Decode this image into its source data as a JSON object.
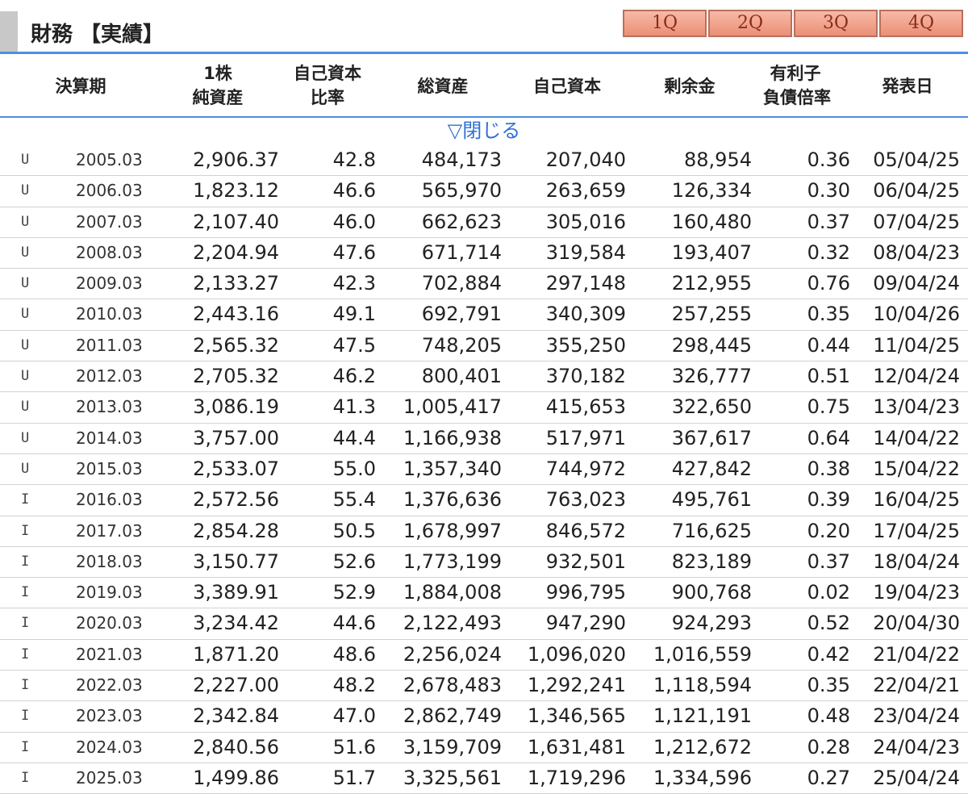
{
  "header": {
    "title": "財務 【実績】",
    "tabs": [
      "1Q",
      "2Q",
      "3Q",
      "4Q"
    ]
  },
  "columns": {
    "period": "決算期",
    "bvps_1": "1株",
    "bvps_2": "純資産",
    "equity_ratio_1": "自己資本",
    "equity_ratio_2": "比率",
    "total_assets": "総資産",
    "equity": "自己資本",
    "surplus": "剰余金",
    "debt_1": "有利子",
    "debt_2": "負債倍率",
    "announce": "発表日"
  },
  "toggle_label": "▽閉じる",
  "rows": [
    {
      "flag": "U",
      "period": "2005.03",
      "bvps": "2,906.37",
      "ratio": "42.8",
      "assets": "484,173",
      "equity": "207,040",
      "surplus": "88,954",
      "debt": "0.36",
      "date": "05/04/25"
    },
    {
      "flag": "U",
      "period": "2006.03",
      "bvps": "1,823.12",
      "ratio": "46.6",
      "assets": "565,970",
      "equity": "263,659",
      "surplus": "126,334",
      "debt": "0.30",
      "date": "06/04/25"
    },
    {
      "flag": "U",
      "period": "2007.03",
      "bvps": "2,107.40",
      "ratio": "46.0",
      "assets": "662,623",
      "equity": "305,016",
      "surplus": "160,480",
      "debt": "0.37",
      "date": "07/04/25"
    },
    {
      "flag": "U",
      "period": "2008.03",
      "bvps": "2,204.94",
      "ratio": "47.6",
      "assets": "671,714",
      "equity": "319,584",
      "surplus": "193,407",
      "debt": "0.32",
      "date": "08/04/23"
    },
    {
      "flag": "U",
      "period": "2009.03",
      "bvps": "2,133.27",
      "ratio": "42.3",
      "assets": "702,884",
      "equity": "297,148",
      "surplus": "212,955",
      "debt": "0.76",
      "date": "09/04/24"
    },
    {
      "flag": "U",
      "period": "2010.03",
      "bvps": "2,443.16",
      "ratio": "49.1",
      "assets": "692,791",
      "equity": "340,309",
      "surplus": "257,255",
      "debt": "0.35",
      "date": "10/04/26"
    },
    {
      "flag": "U",
      "period": "2011.03",
      "bvps": "2,565.32",
      "ratio": "47.5",
      "assets": "748,205",
      "equity": "355,250",
      "surplus": "298,445",
      "debt": "0.44",
      "date": "11/04/25"
    },
    {
      "flag": "U",
      "period": "2012.03",
      "bvps": "2,705.32",
      "ratio": "46.2",
      "assets": "800,401",
      "equity": "370,182",
      "surplus": "326,777",
      "debt": "0.51",
      "date": "12/04/24"
    },
    {
      "flag": "U",
      "period": "2013.03",
      "bvps": "3,086.19",
      "ratio": "41.3",
      "assets": "1,005,417",
      "equity": "415,653",
      "surplus": "322,650",
      "debt": "0.75",
      "date": "13/04/23"
    },
    {
      "flag": "U",
      "period": "2014.03",
      "bvps": "3,757.00",
      "ratio": "44.4",
      "assets": "1,166,938",
      "equity": "517,971",
      "surplus": "367,617",
      "debt": "0.64",
      "date": "14/04/22"
    },
    {
      "flag": "U",
      "period": "2015.03",
      "bvps": "2,533.07",
      "ratio": "55.0",
      "assets": "1,357,340",
      "equity": "744,972",
      "surplus": "427,842",
      "debt": "0.38",
      "date": "15/04/22"
    },
    {
      "flag": "I",
      "period": "2016.03",
      "bvps": "2,572.56",
      "ratio": "55.4",
      "assets": "1,376,636",
      "equity": "763,023",
      "surplus": "495,761",
      "debt": "0.39",
      "date": "16/04/25"
    },
    {
      "flag": "I",
      "period": "2017.03",
      "bvps": "2,854.28",
      "ratio": "50.5",
      "assets": "1,678,997",
      "equity": "846,572",
      "surplus": "716,625",
      "debt": "0.20",
      "date": "17/04/25"
    },
    {
      "flag": "I",
      "period": "2018.03",
      "bvps": "3,150.77",
      "ratio": "52.6",
      "assets": "1,773,199",
      "equity": "932,501",
      "surplus": "823,189",
      "debt": "0.37",
      "date": "18/04/24"
    },
    {
      "flag": "I",
      "period": "2019.03",
      "bvps": "3,389.91",
      "ratio": "52.9",
      "assets": "1,884,008",
      "equity": "996,795",
      "surplus": "900,768",
      "debt": "0.02",
      "date": "19/04/23"
    },
    {
      "flag": "I",
      "period": "2020.03",
      "bvps": "3,234.42",
      "ratio": "44.6",
      "assets": "2,122,493",
      "equity": "947,290",
      "surplus": "924,293",
      "debt": "0.52",
      "date": "20/04/30"
    },
    {
      "flag": "I",
      "period": "2021.03",
      "bvps": "1,871.20",
      "ratio": "48.6",
      "assets": "2,256,024",
      "equity": "1,096,020",
      "surplus": "1,016,559",
      "debt": "0.42",
      "date": "21/04/22"
    },
    {
      "flag": "I",
      "period": "2022.03",
      "bvps": "2,227.00",
      "ratio": "48.2",
      "assets": "2,678,483",
      "equity": "1,292,241",
      "surplus": "1,118,594",
      "debt": "0.35",
      "date": "22/04/21"
    },
    {
      "flag": "I",
      "period": "2023.03",
      "bvps": "2,342.84",
      "ratio": "47.0",
      "assets": "2,862,749",
      "equity": "1,346,565",
      "surplus": "1,121,191",
      "debt": "0.48",
      "date": "23/04/24"
    },
    {
      "flag": "I",
      "period": "2024.03",
      "bvps": "2,840.56",
      "ratio": "51.6",
      "assets": "3,159,709",
      "equity": "1,631,481",
      "surplus": "1,212,672",
      "debt": "0.28",
      "date": "24/04/23"
    },
    {
      "flag": "I",
      "period": "2025.03",
      "bvps": "1,499.86",
      "ratio": "51.7",
      "assets": "3,325,561",
      "equity": "1,719,296",
      "surplus": "1,334,596",
      "debt": "0.27",
      "date": "25/04/24"
    }
  ]
}
